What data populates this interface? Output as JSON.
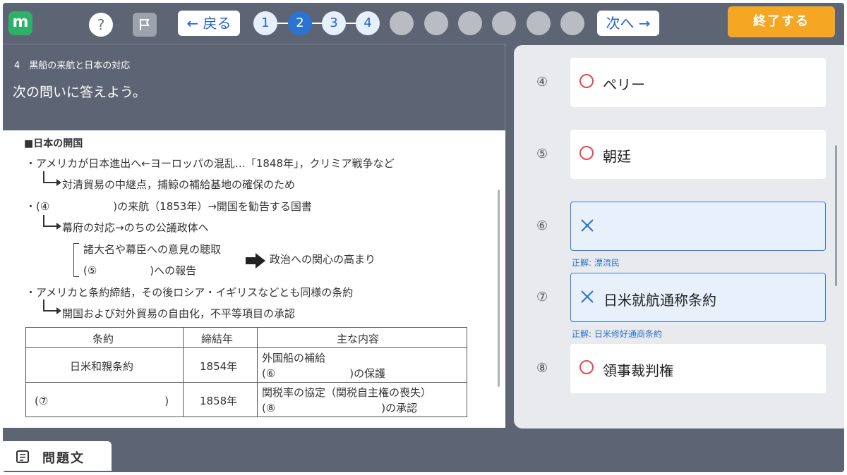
{
  "app": {
    "logo_letter": "m"
  },
  "toolbar": {
    "help_label": "?",
    "back_label": "← 戻る",
    "next_label": "次へ →",
    "finish_label": "終了する",
    "steps": [
      "1",
      "2",
      "3",
      "4"
    ]
  },
  "question": {
    "number_title": "4　黒船の来航と日本の対応",
    "prompt": "次の問いに答えよう。"
  },
  "document": {
    "heading": "■日本の開国",
    "line1": "・アメリカが日本進出へ←ヨーロッパの混乱…「1848年」，クリミア戦争など",
    "line2": "対清貿易の中継点，捕鯨の補給基地の確保のため",
    "line3": "・(④　　　　　　)の来航（1853年）→開国を勧告する国書",
    "line4": "幕府の対応→のちの公議政体へ",
    "line5": "諸大名や幕臣への意見の聴取",
    "line6": "(⑤　　　　　)への報告",
    "line7": "政治への関心の高まり",
    "line8": "・アメリカと条約締結，その後ロシア・イギリスなどとも同様の条約",
    "line9": "開国および対外貿易の自由化，不平等項目の承認",
    "table": {
      "headers": [
        "条約",
        "締結年",
        "主な内容"
      ],
      "row1": {
        "treaty": "日米和親条約",
        "year": "1854年",
        "content1": "外国船の補給",
        "content2": "(⑥　　　　　　　)の保護"
      },
      "row2": {
        "treaty": "(⑦　　　　　　　　　　　)",
        "year": "1858年",
        "content1": "関税率の協定（関税自主権の喪失）",
        "content2": "(⑧　　　　　　　　　　)の承認"
      }
    }
  },
  "answers": [
    {
      "label": "④",
      "text": "ペリー",
      "status": "correct"
    },
    {
      "label": "⑤",
      "text": "朝廷",
      "status": "correct"
    },
    {
      "label": "⑥",
      "text": "",
      "status": "wrong",
      "correct": "正解: 漂流民"
    },
    {
      "label": "⑦",
      "text": "日米就航通称条約",
      "status": "wrong",
      "correct": "正解: 日米修好通商条約"
    },
    {
      "label": "⑧",
      "text": "領事裁判権",
      "status": "correct"
    }
  ],
  "bottom_tab": {
    "label": "問題文"
  },
  "colors": {
    "accent": "#2b73d3",
    "finish": "#f5a623",
    "logo": "#2fb069",
    "correct_mark": "#e5484d",
    "wrong_mark": "#2b6fcf"
  }
}
